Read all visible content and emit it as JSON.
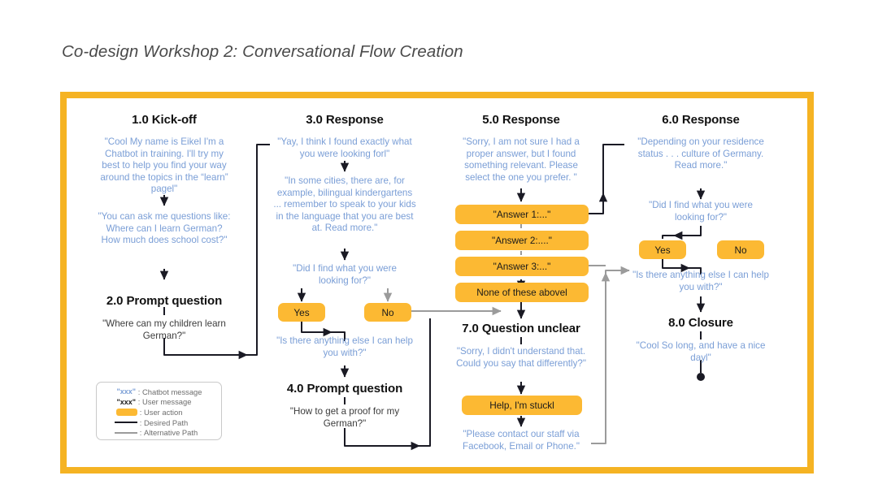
{
  "page": {
    "title": "Co-design Workshop 2: Conversational Flow Creation",
    "frame_color": "#f5b323",
    "bot_text_color": "#7a9ed6",
    "user_text_color": "#3c3c3c",
    "action_pill_color": "#fcb933",
    "desired_path_color": "#1a1a24",
    "alternative_path_color": "#9b9b9b"
  },
  "columns": [
    {
      "id": "col-1",
      "heading": "1.0 Kick-off",
      "heading2": "2.0 Prompt question",
      "blocks": [
        "\"Cool My name is  Eikel I'm a Chatbot in training. I'll try my best to help you find your way around the topics in the “learn” pagel\"",
        "\"You can ask me questions like:\nWhere can I learn German?\nHow much does school cost?\"",
        "\"Where can my children learn German?\""
      ]
    },
    {
      "id": "col-2",
      "heading": "3.0 Response",
      "heading2": "4.0 Prompt question",
      "blocks": [
        "\"Yay, I think I found exactly what you were looking forl\"",
        "\"In some cities, there are, for example, bilingual kindergartens ... remember to speak to your kids in the language that you are best at. Read more.\"",
        "\"Did I find what you were looking for?\"",
        "\"Is there anything else I can help you with?\"",
        "\"How to get a proof for my German?\""
      ],
      "pills": [
        "Yes",
        "No"
      ]
    },
    {
      "id": "col-3",
      "heading": "5.0 Response",
      "heading2": "7.0 Question unclear",
      "blocks": [
        "\"Sorry, I am not sure I had a proper answer, but I found something relevant. Please select the one you prefer. \"",
        "\"Sorry, I didn't understand that. Could you say that differently?\"",
        "\"Please contact our staff via Facebook, Email or Phone.\""
      ],
      "pills": [
        "\"Answer 1:...\"",
        "\"Answer 2:....\"",
        "\"Answer 3:...\"",
        "None of these abovel",
        "Help, I'm stuckl"
      ]
    },
    {
      "id": "col-4",
      "heading": "6.0 Response",
      "heading2": "8.0 Closure",
      "blocks": [
        "\"Depending on your residence status . . .  culture of Germany.\nRead more.\"",
        "\"Did I find what you were looking for?\"",
        "\"Is there anything else I can help you with?\"",
        "\"Cool So long, and have a nice dayl\""
      ],
      "pills": [
        "Yes",
        "No"
      ]
    }
  ],
  "legend": {
    "rows": [
      {
        "key": "\"xxx\"",
        "sep": ":",
        "label": "Chatbot message",
        "type": "bot-text"
      },
      {
        "key": "\"xxx\"",
        "sep": ":",
        "label": "User message",
        "type": "user-text"
      },
      {
        "key": "",
        "sep": ":",
        "label": "User action",
        "type": "pill"
      },
      {
        "key": "",
        "sep": ":",
        "label": "Desired Path",
        "type": "line-dark"
      },
      {
        "key": "",
        "sep": ":",
        "label": "Alternative Path",
        "type": "line-grey"
      }
    ]
  }
}
